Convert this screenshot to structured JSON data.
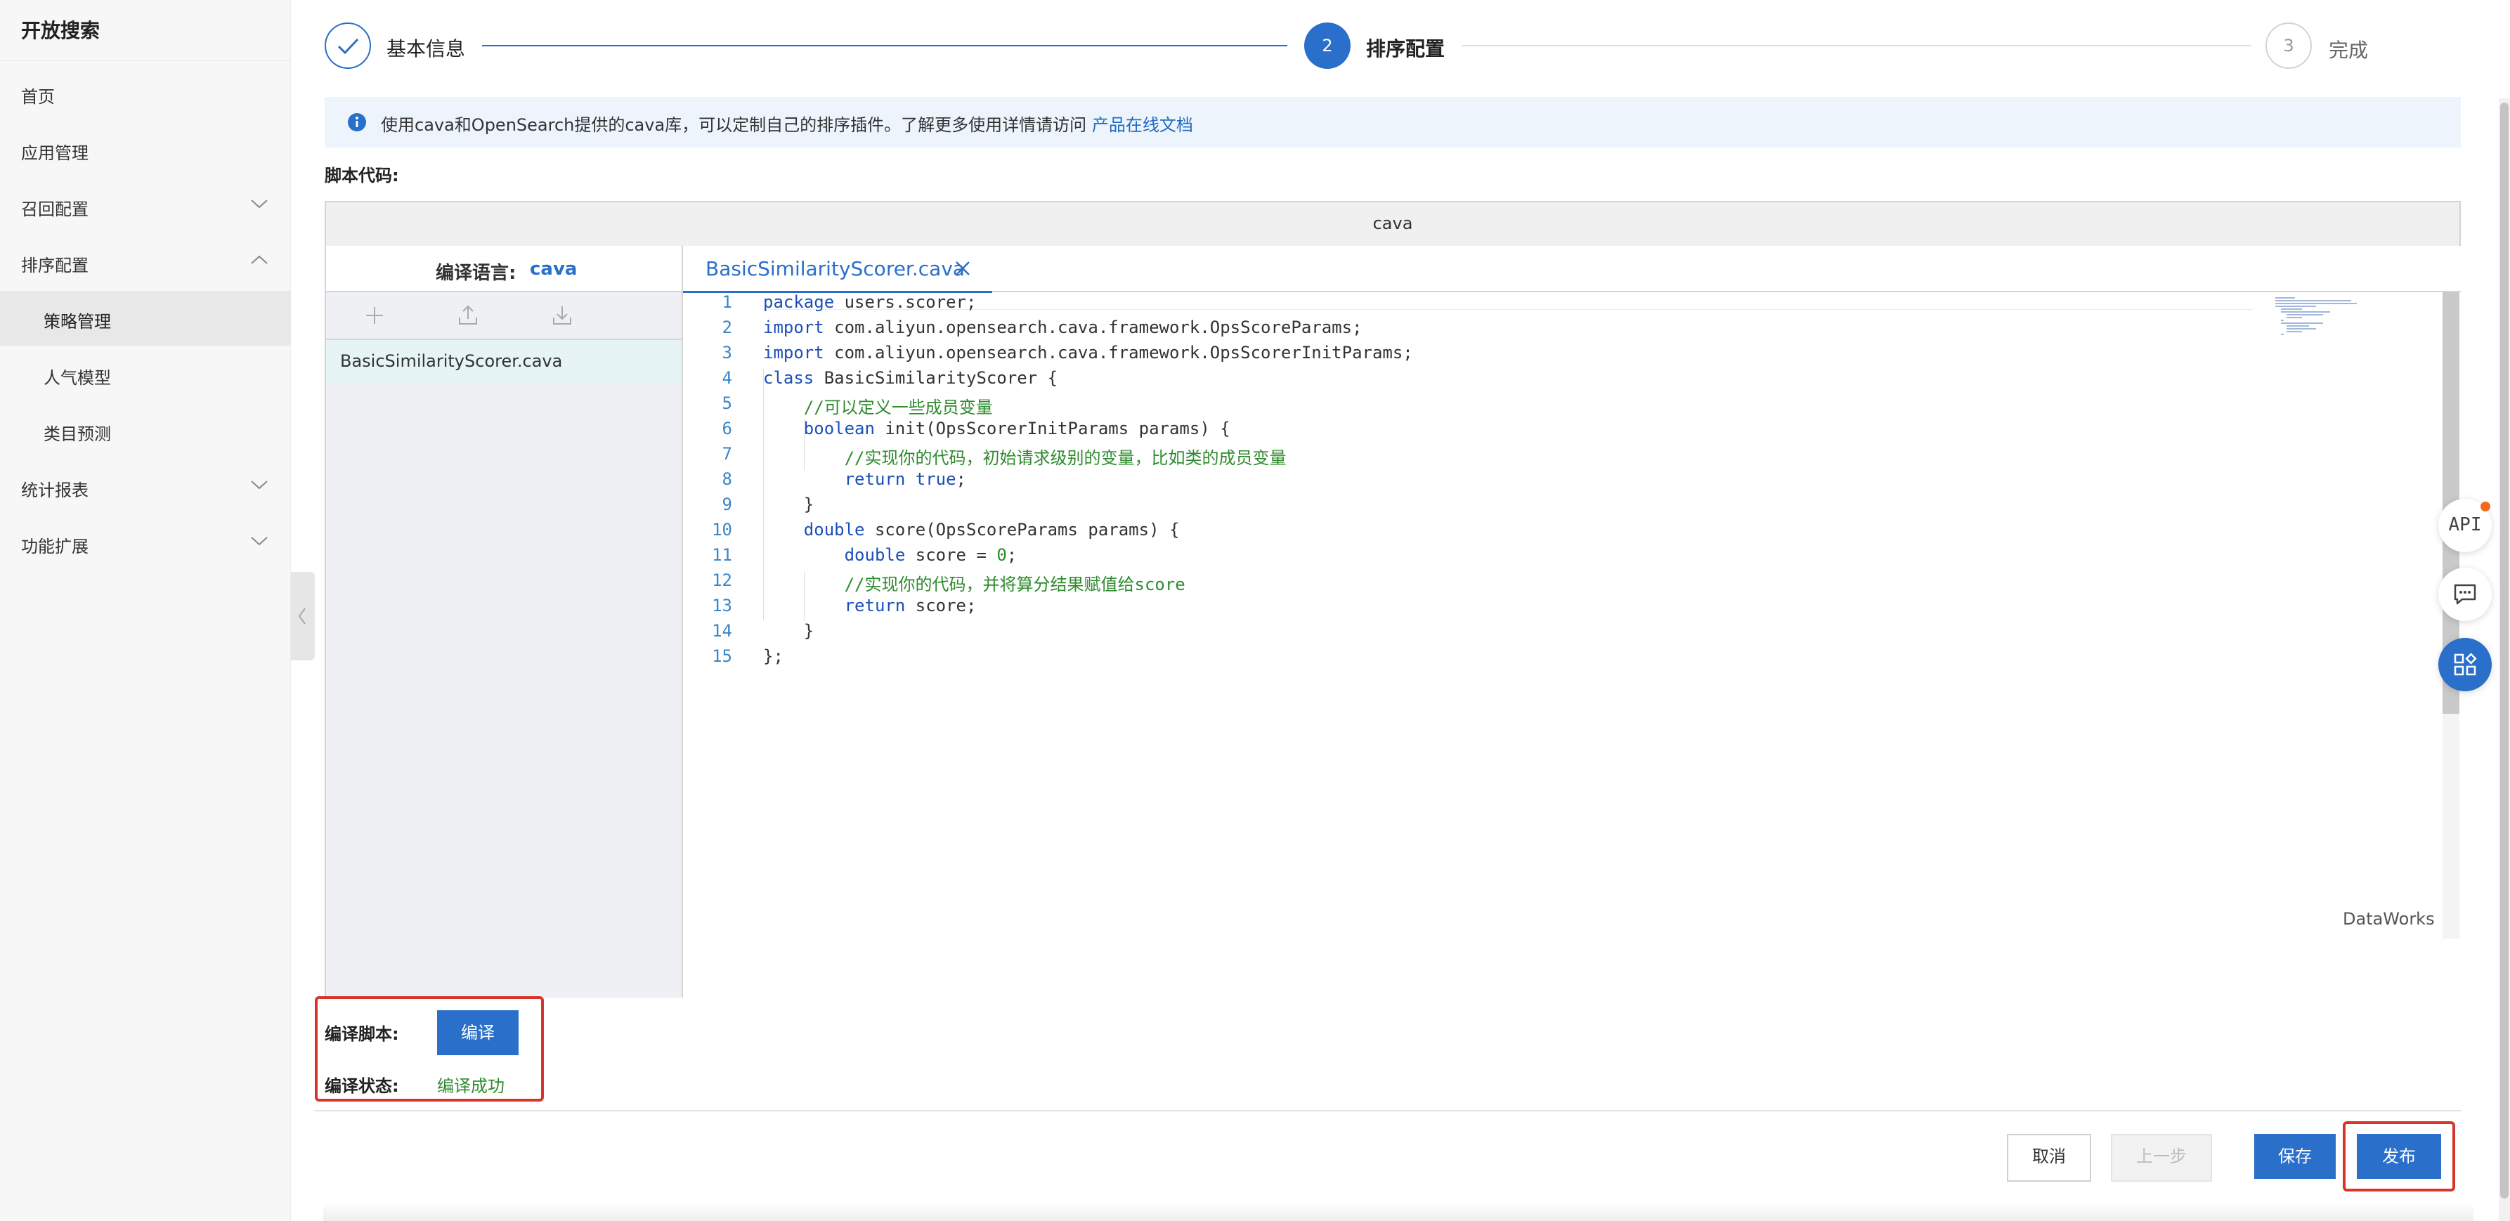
{
  "sidebar": {
    "title": "开放搜索",
    "items": [
      {
        "label": "首页"
      },
      {
        "label": "应用管理"
      },
      {
        "label": "召回配置"
      },
      {
        "label": "排序配置"
      },
      {
        "label": "策略管理"
      },
      {
        "label": "人气模型"
      },
      {
        "label": "类目预测"
      },
      {
        "label": "统计报表"
      },
      {
        "label": "功能扩展"
      }
    ]
  },
  "steps": [
    {
      "label": "基本信息",
      "status": "done"
    },
    {
      "number": "2",
      "label": "排序配置",
      "status": "active"
    },
    {
      "number": "3",
      "label": "完成",
      "status": "pending"
    }
  ],
  "info": {
    "text": "使用cava和OpenSearch提供的cava库，可以定制自己的排序插件。了解更多使用详情请访问",
    "link": "产品在线文档"
  },
  "script_label": "脚本代码:",
  "editor": {
    "header": "cava",
    "lang_label": "编译语言:",
    "lang_value": "cava",
    "file": "BasicSimilarityScorer.cava",
    "tab": "BasicSimilarityScorer.cava",
    "watermark": "DataWorks",
    "lines": [
      "package users.scorer;",
      "import com.aliyun.opensearch.cava.framework.OpsScoreParams;",
      "import com.aliyun.opensearch.cava.framework.OpsScorerInitParams;",
      "class BasicSimilarityScorer {",
      "    //可以定义一些成员变量",
      "    boolean init(OpsScorerInitParams params) {",
      "        //实现你的代码，初始请求级别的变量，比如类的成员变量",
      "        return true;",
      "    }",
      "    double score(OpsScoreParams params) {",
      "        double score = 0;",
      "        //实现你的代码，并将算分结果赋值给score",
      "        return score;",
      "    }",
      "};"
    ]
  },
  "compile": {
    "script_label": "编译脚本:",
    "button": "编译",
    "status_label": "编译状态:",
    "status_value": "编译成功"
  },
  "footer": {
    "cancel": "取消",
    "prev": "上一步",
    "save": "保存",
    "publish": "发布"
  },
  "float": {
    "api": "API"
  },
  "colors": {
    "primary": "#2a6fc9",
    "success": "#2e8b2e",
    "highlight": "#d9342b"
  }
}
